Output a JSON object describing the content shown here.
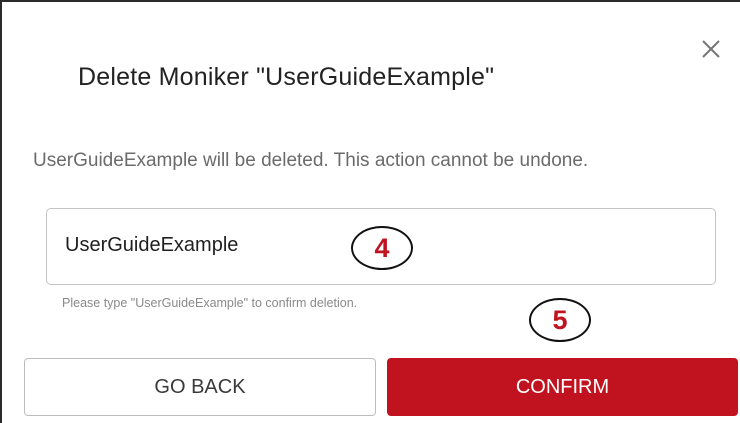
{
  "dialog": {
    "title": "Delete Moniker \"UserGuideExample\"",
    "message": "UserGuideExample will be deleted. This action cannot be undone.",
    "close_icon": "close-icon"
  },
  "confirm_input": {
    "value": "UserGuideExample",
    "hint": "Please type \"UserGuideExample\" to confirm deletion."
  },
  "annotations": {
    "step_4": "4",
    "step_5": "5"
  },
  "buttons": {
    "back_label": "GO BACK",
    "confirm_label": "CONFIRM"
  },
  "colors": {
    "accent": "#c0131f",
    "callout_text": "#c0131f"
  }
}
